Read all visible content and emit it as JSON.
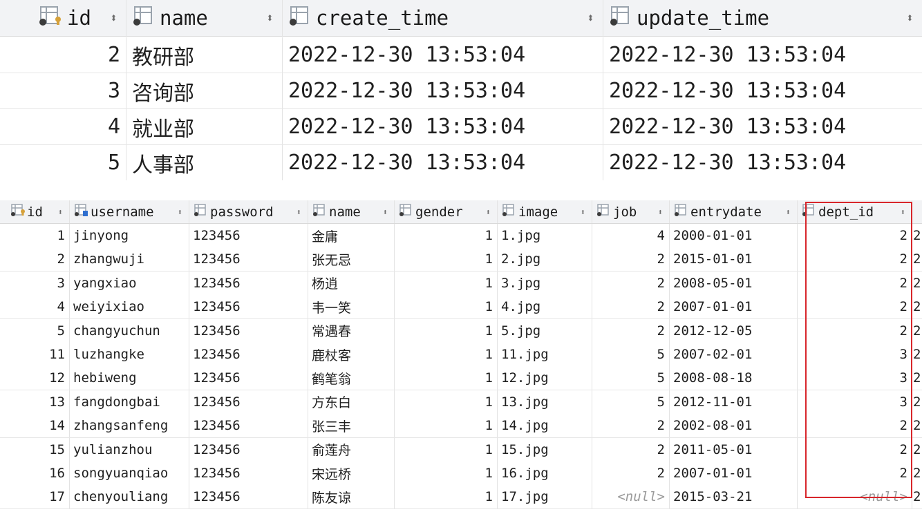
{
  "top_table": {
    "columns": [
      {
        "name": "id",
        "icon": "primary-key-icon"
      },
      {
        "name": "name",
        "icon": "column-icon"
      },
      {
        "name": "create_time",
        "icon": "column-icon"
      },
      {
        "name": "update_time",
        "icon": "column-icon"
      }
    ],
    "sort_glyph": "⬍",
    "rows": [
      [
        "2",
        "教研部",
        "2022-12-30 13:53:04",
        "2022-12-30 13:53:04"
      ],
      [
        "3",
        "咨询部",
        "2022-12-30 13:53:04",
        "2022-12-30 13:53:04"
      ],
      [
        "4",
        "就业部",
        "2022-12-30 13:53:04",
        "2022-12-30 13:53:04"
      ],
      [
        "5",
        "人事部",
        "2022-12-30 13:53:04",
        "2022-12-30 13:53:04"
      ]
    ]
  },
  "bottom_table": {
    "columns": [
      {
        "name": "id",
        "icon": "primary-key-icon"
      },
      {
        "name": "username",
        "icon": "unique-column-icon"
      },
      {
        "name": "password",
        "icon": "column-icon"
      },
      {
        "name": "name",
        "icon": "column-icon"
      },
      {
        "name": "gender",
        "icon": "column-icon"
      },
      {
        "name": "image",
        "icon": "column-icon"
      },
      {
        "name": "job",
        "icon": "column-icon"
      },
      {
        "name": "entrydate",
        "icon": "column-icon"
      },
      {
        "name": "dept_id",
        "icon": "column-icon"
      }
    ],
    "rows": [
      [
        "1",
        "jinyong",
        "123456",
        "金庸",
        "1",
        "1.jpg",
        "4",
        "2000-01-01",
        "2",
        "2"
      ],
      [
        "2",
        "zhangwuji",
        "123456",
        "张无忌",
        "1",
        "2.jpg",
        "2",
        "2015-01-01",
        "2",
        "2"
      ],
      [
        "3",
        "yangxiao",
        "123456",
        "杨逍",
        "1",
        "3.jpg",
        "2",
        "2008-05-01",
        "2",
        "2"
      ],
      [
        "4",
        "weiyixiao",
        "123456",
        "韦一笑",
        "1",
        "4.jpg",
        "2",
        "2007-01-01",
        "2",
        "2"
      ],
      [
        "5",
        "changyuchun",
        "123456",
        "常遇春",
        "1",
        "5.jpg",
        "2",
        "2012-12-05",
        "2",
        "2"
      ],
      [
        "11",
        "luzhangke",
        "123456",
        "鹿杖客",
        "1",
        "11.jpg",
        "5",
        "2007-02-01",
        "3",
        "2"
      ],
      [
        "12",
        "hebiweng",
        "123456",
        "鹤笔翁",
        "1",
        "12.jpg",
        "5",
        "2008-08-18",
        "3",
        "2"
      ],
      [
        "13",
        "fangdongbai",
        "123456",
        "方东白",
        "1",
        "13.jpg",
        "5",
        "2012-11-01",
        "3",
        "2"
      ],
      [
        "14",
        "zhangsanfeng",
        "123456",
        "张三丰",
        "1",
        "14.jpg",
        "2",
        "2002-08-01",
        "2",
        "2"
      ],
      [
        "15",
        "yulianzhou",
        "123456",
        "俞莲舟",
        "1",
        "15.jpg",
        "2",
        "2011-05-01",
        "2",
        "2"
      ],
      [
        "16",
        "songyuanqiao",
        "123456",
        "宋远桥",
        "1",
        "16.jpg",
        "2",
        "2007-01-01",
        "2",
        "2"
      ],
      [
        "17",
        "chenyouliang",
        "123456",
        "陈友谅",
        "1",
        "17.jpg",
        "<null>",
        "2015-03-21",
        "<null>",
        "2"
      ]
    ]
  },
  "colors": {
    "highlight": "#d8262b",
    "header_bg": "#f2f3f5",
    "key_gold": "#d6a13a"
  }
}
